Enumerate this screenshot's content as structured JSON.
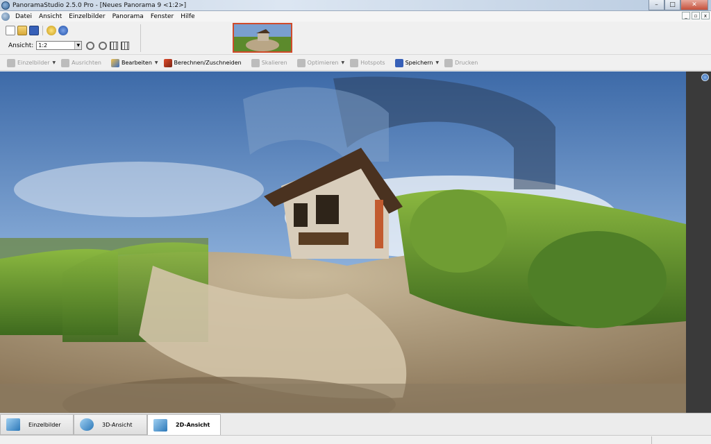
{
  "window": {
    "title": "PanoramaStudio 2.5.0 Pro - [Neues Panorama 9 <1:2>]"
  },
  "menu": [
    "Datei",
    "Ansicht",
    "Einzelbilder",
    "Panorama",
    "Fenster",
    "Hilfe"
  ],
  "view": {
    "label": "Ansicht:",
    "value": "1:2"
  },
  "toolbar2": [
    {
      "label": "Einzelbilder",
      "icon": "images-icon",
      "enabled": false
    },
    {
      "label": "Ausrichten",
      "icon": "align-icon",
      "enabled": false
    },
    {
      "label": "Bearbeiten",
      "icon": "edit-icon",
      "enabled": true
    },
    {
      "label": "Berechnen/Zuschneiden",
      "icon": "crop-icon",
      "enabled": true
    },
    {
      "label": "Skalieren",
      "icon": "scale-icon",
      "enabled": false
    },
    {
      "label": "Optimieren",
      "icon": "optimize-icon",
      "enabled": false
    },
    {
      "label": "Hotspots",
      "icon": "hotspot-icon",
      "enabled": false
    },
    {
      "label": "Speichern",
      "icon": "save-icon",
      "enabled": true
    },
    {
      "label": "Drucken",
      "icon": "print-icon",
      "enabled": false
    }
  ],
  "tabs": [
    {
      "label": "Einzelbilder",
      "active": false
    },
    {
      "label": "3D-Ansicht",
      "active": false
    },
    {
      "label": "2D-Ansicht",
      "active": true
    }
  ],
  "colors": {
    "accent": "#d04a2a",
    "sky": "#5f8ec8",
    "grass": "#5c8a2c",
    "soil": "#b8a487"
  }
}
